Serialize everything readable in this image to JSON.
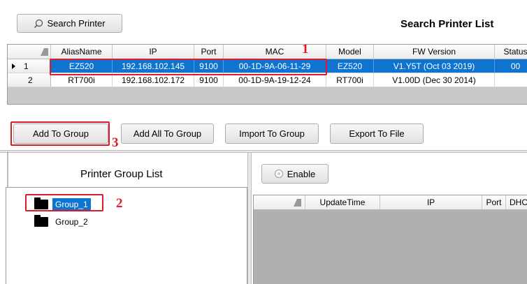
{
  "search": {
    "button_label": "Search Printer",
    "title": "Search Printer List"
  },
  "printer_table": {
    "columns": [
      "AliasName",
      "IP",
      "Port",
      "MAC",
      "Model",
      "FW Version",
      "Status"
    ],
    "rows": [
      {
        "num": "1",
        "alias": "EZ520",
        "ip": "192.168.102.145",
        "port": "9100",
        "mac": "00-1D-9A-06-11-29",
        "model": "EZ520",
        "fw": "V1.Y5T (Oct 03 2019)",
        "status": "00"
      },
      {
        "num": "2",
        "alias": "RT700i",
        "ip": "192.168.102.172",
        "port": "9100",
        "mac": "00-1D-9A-19-12-24",
        "model": "RT700i",
        "fw": "V1.00D (Dec 30 2014)",
        "status": ""
      }
    ]
  },
  "actions": {
    "add_to_group": "Add To Group",
    "add_all": "Add All To Group",
    "import": "Import To Group",
    "export": "Export To File"
  },
  "group_panel": {
    "title": "Printer Group List",
    "groups": [
      "Group_1",
      "Group_2"
    ]
  },
  "detail": {
    "enable_label": "Enable",
    "columns": [
      "UpdateTime",
      "IP",
      "Port",
      "DHCF"
    ]
  },
  "annotations": [
    "1",
    "2",
    "3"
  ],
  "colors": {
    "selection": "#0f74d0",
    "annotation": "#e0192a"
  },
  "icons": {
    "search": "search-icon",
    "row_pointer": "row-pointer-icon",
    "folder": "folder-icon",
    "radio": "radio-icon"
  }
}
